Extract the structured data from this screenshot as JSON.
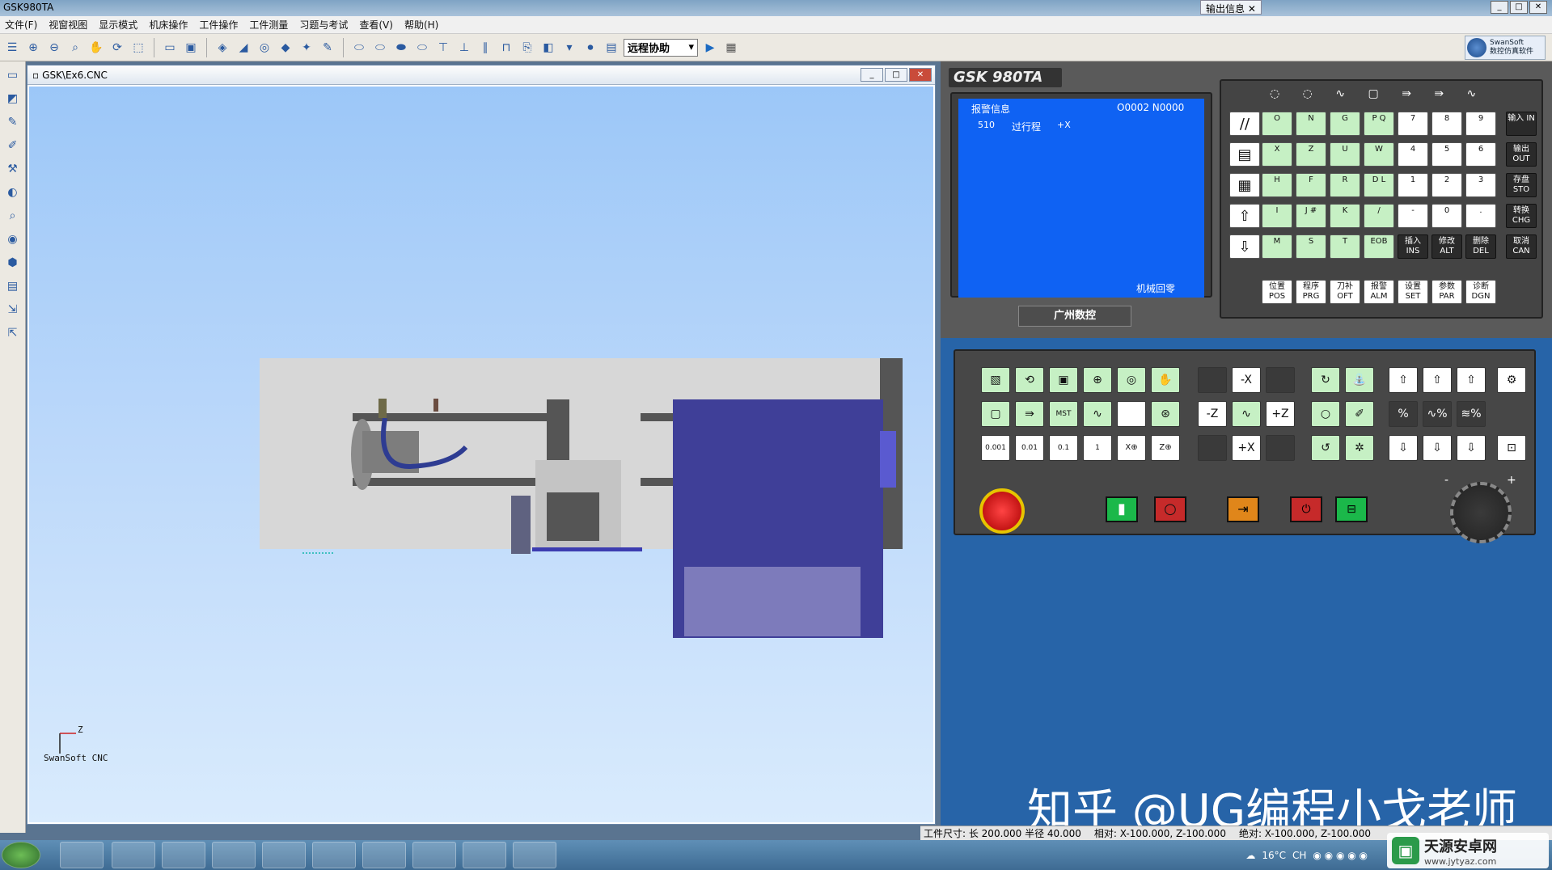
{
  "app": {
    "title": "GSK980TA"
  },
  "output_tab": {
    "label": "输出信息"
  },
  "menu": [
    "文件(F)",
    "视窗视图",
    "显示模式",
    "机床操作",
    "工件操作",
    "工件测量",
    "习题与考试",
    "查看(V)",
    "帮助(H)"
  ],
  "toolbar": {
    "remote_assist": "远程协助"
  },
  "swan": {
    "line1": "SwanSoft",
    "line2": "数控仿真软件"
  },
  "viewer": {
    "title": "GSK\\Ex6.CNC",
    "axis_z": "Z",
    "brand": "SwanSoft CNC"
  },
  "cnc": {
    "logo": "GSK 980TA",
    "screen": {
      "header_left": "报警信息",
      "header_right": "O0002  N0000",
      "alarm_code": "510",
      "alarm_text": "过行程",
      "alarm_axis": "+X",
      "mode": "机械回零"
    },
    "brand": "广州数控",
    "keys_row1": [
      "//",
      "O",
      "N",
      "G",
      "P Q",
      "7",
      "8",
      "9",
      "输入 IN"
    ],
    "keys_row2": [
      "X",
      "Z",
      "U",
      "W",
      "4",
      "5",
      "6",
      "输出 OUT"
    ],
    "keys_row3": [
      "H",
      "F",
      "R",
      "D L",
      "1",
      "2",
      "3",
      "存盘 STO"
    ],
    "keys_row4": [
      "I",
      "J #",
      "K",
      "/",
      "-",
      "0",
      ".",
      "转换 CHG"
    ],
    "keys_row5": [
      "M",
      "S",
      "T",
      "EOB",
      "插入 INS",
      "修改 ALT",
      "删除 DEL",
      "取消 CAN"
    ],
    "func_keys": [
      "位置 POS",
      "程序 PRG",
      "刀补 OFT",
      "报警 ALM",
      "设置 SET",
      "参数 PAR",
      "诊断 DGN"
    ],
    "jog": {
      "minus_x": "-X",
      "minus_z": "-Z",
      "plus_z": "+Z",
      "plus_x": "+X"
    },
    "step": [
      "0.001",
      "0.01",
      "0.1",
      "1",
      "X⊕",
      "Z⊕"
    ],
    "handwheel": {
      "minus": "-",
      "plus": "+"
    }
  },
  "watermark": "知乎 @UG编程小戈老师",
  "status": {
    "stock": "工件尺寸: 长 200.000 半径 40.000",
    "relative": "相对: X-100.000, Z-100.000",
    "absolute": "绝对: X-100.000, Z-100.000"
  },
  "taskbar": {
    "weather": "16°C",
    "lang": "CH"
  },
  "site": {
    "name": "天源安卓网",
    "url": "www.jytyaz.com"
  }
}
